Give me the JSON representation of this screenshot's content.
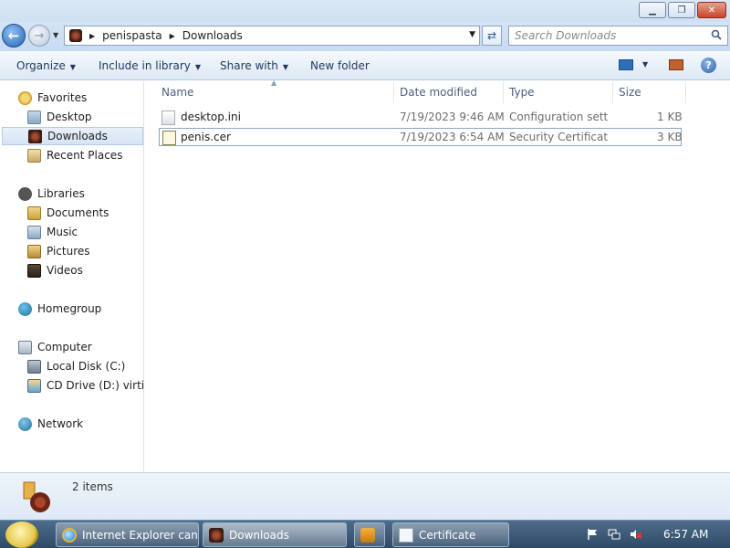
{
  "window": {
    "minimize": "▁",
    "maximize": "❐",
    "close": "✕"
  },
  "address": {
    "crumbs": [
      "penispasta",
      "Downloads"
    ],
    "search_placeholder": "Search Downloads"
  },
  "commands": {
    "organize": "Organize",
    "include_in_library": "Include in library",
    "share_with": "Share with",
    "new_folder": "New folder",
    "help": "?"
  },
  "nav": {
    "favorites": "Favorites",
    "desktop": "Desktop",
    "downloads": "Downloads",
    "recent_places": "Recent Places",
    "libraries": "Libraries",
    "documents": "Documents",
    "music": "Music",
    "pictures": "Pictures",
    "videos": "Videos",
    "homegroup": "Homegroup",
    "computer": "Computer",
    "local_disk": "Local Disk (C:)",
    "cd_drive": "CD Drive (D:) virtio-w",
    "network": "Network"
  },
  "columns": {
    "name": "Name",
    "date": "Date modified",
    "type": "Type",
    "size": "Size"
  },
  "files": [
    {
      "name": "desktop.ini",
      "date": "7/19/2023 9:46 AM",
      "type": "Configuration sett...",
      "size": "1 KB",
      "icon": "settings-file-icon"
    },
    {
      "name": "penis.cer",
      "date": "7/19/2023 6:54 AM",
      "type": "Security Certificate",
      "size": "3 KB",
      "icon": "certificate-file-icon"
    }
  ],
  "details": {
    "count": "2 items"
  },
  "taskbar": {
    "items": [
      {
        "label": "Internet Explorer can...",
        "icon": "internet-explorer-icon"
      },
      {
        "label": "Downloads",
        "icon": "folder-icon"
      },
      {
        "label": "",
        "icon": "media-player-icon"
      },
      {
        "label": "Certificate",
        "icon": "certificate-icon"
      }
    ],
    "clock": "6:57 AM"
  }
}
